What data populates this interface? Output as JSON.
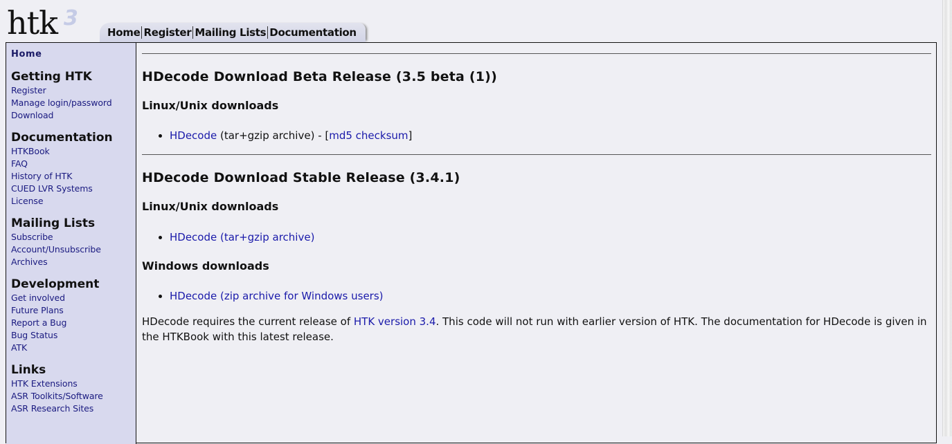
{
  "logo": {
    "text": "htk",
    "superscript": "3"
  },
  "top_nav": [
    {
      "label": "Home"
    },
    {
      "label": "Register"
    },
    {
      "label": "Mailing Lists"
    },
    {
      "label": "Documentation"
    }
  ],
  "sidebar": {
    "home_label": "Home",
    "sections": [
      {
        "title": "Getting HTK",
        "items": [
          {
            "label": "Register"
          },
          {
            "label": "Manage login/password"
          },
          {
            "label": "Download"
          }
        ]
      },
      {
        "title": "Documentation",
        "items": [
          {
            "label": "HTKBook"
          },
          {
            "label": "FAQ"
          },
          {
            "label": "History of HTK"
          },
          {
            "label": "CUED LVR Systems"
          },
          {
            "label": "License"
          }
        ]
      },
      {
        "title": "Mailing Lists",
        "items": [
          {
            "label": "Subscribe"
          },
          {
            "label": "Account/Unsubscribe"
          },
          {
            "label": "Archives"
          }
        ]
      },
      {
        "title": "Development",
        "items": [
          {
            "label": "Get involved"
          },
          {
            "label": "Future Plans"
          },
          {
            "label": "Report a Bug"
          },
          {
            "label": "Bug Status"
          },
          {
            "label": "ATK"
          }
        ]
      },
      {
        "title": "Links",
        "items": [
          {
            "label": "HTK Extensions"
          },
          {
            "label": "ASR Toolkits/Software"
          },
          {
            "label": "ASR Research Sites"
          }
        ]
      }
    ]
  },
  "content": {
    "beta": {
      "heading": "HDecode Download Beta Release (3.5 beta (1))",
      "subheading": "Linux/Unix downloads",
      "link_label": "HDecode",
      "link_suffix": " (tar+gzip archive) - [",
      "checksum_label": "md5 checksum",
      "close_bracket": "]"
    },
    "stable": {
      "heading": "HDecode Download Stable Release (3.4.1)",
      "linux_subheading": "Linux/Unix downloads",
      "linux_link_label": "HDecode (tar+gzip archive)",
      "windows_subheading": "Windows downloads",
      "windows_link_label": "HDecode (zip archive for Windows users)"
    },
    "note": {
      "prefix": "HDecode requires the current release of ",
      "link_label": "HTK version 3.4",
      "suffix": ". This code will not run with earlier version of HTK. The documentation for HDecode is given in the HTKBook with this latest release."
    }
  }
}
